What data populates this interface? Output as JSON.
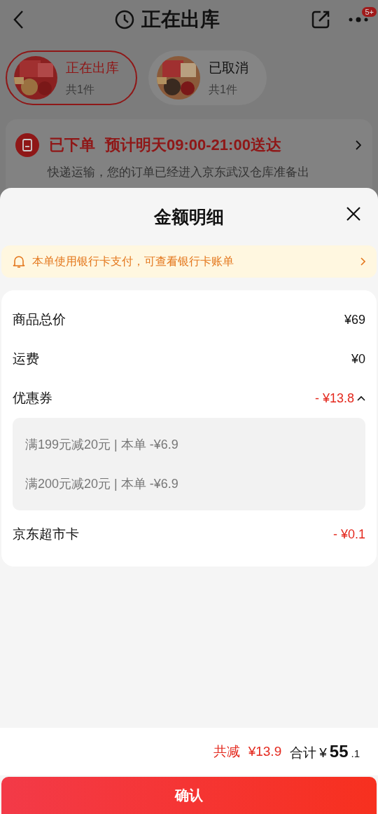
{
  "header": {
    "title": "正在出库",
    "badge": "5+"
  },
  "packages": [
    {
      "status": "正在出库",
      "count": "共1件",
      "selected": true
    },
    {
      "status": "已取消",
      "count": "共1件",
      "selected": false
    }
  ],
  "order_status": {
    "title": "已下单",
    "eta": "预计明天09:00-21:00送达",
    "detail": "快递运输，您的订单已经进入京东武汉仓库准备出"
  },
  "sheet": {
    "title": "金额明细",
    "notice": "本单使用银行卡支付，可查看银行卡账单",
    "rows": [
      {
        "kind": "plain",
        "label": "商品总价",
        "value": "¥69"
      },
      {
        "kind": "plain",
        "label": "运费",
        "value": "¥0"
      },
      {
        "kind": "expandable",
        "label": "优惠券",
        "value": "- ¥13.8",
        "expanded": true,
        "details": [
          "满199元减20元 | 本单 -¥6.9",
          "满200元减20元 | 本单 -¥6.9"
        ]
      },
      {
        "kind": "discount",
        "label": "京东超市卡",
        "value": "- ¥0.1"
      }
    ]
  },
  "footer": {
    "saved_label": "共减",
    "saved": "¥13.9",
    "total_label": "合计",
    "currency": "¥",
    "total_int": "55",
    "total_dec": ".1",
    "confirm": "确认"
  }
}
